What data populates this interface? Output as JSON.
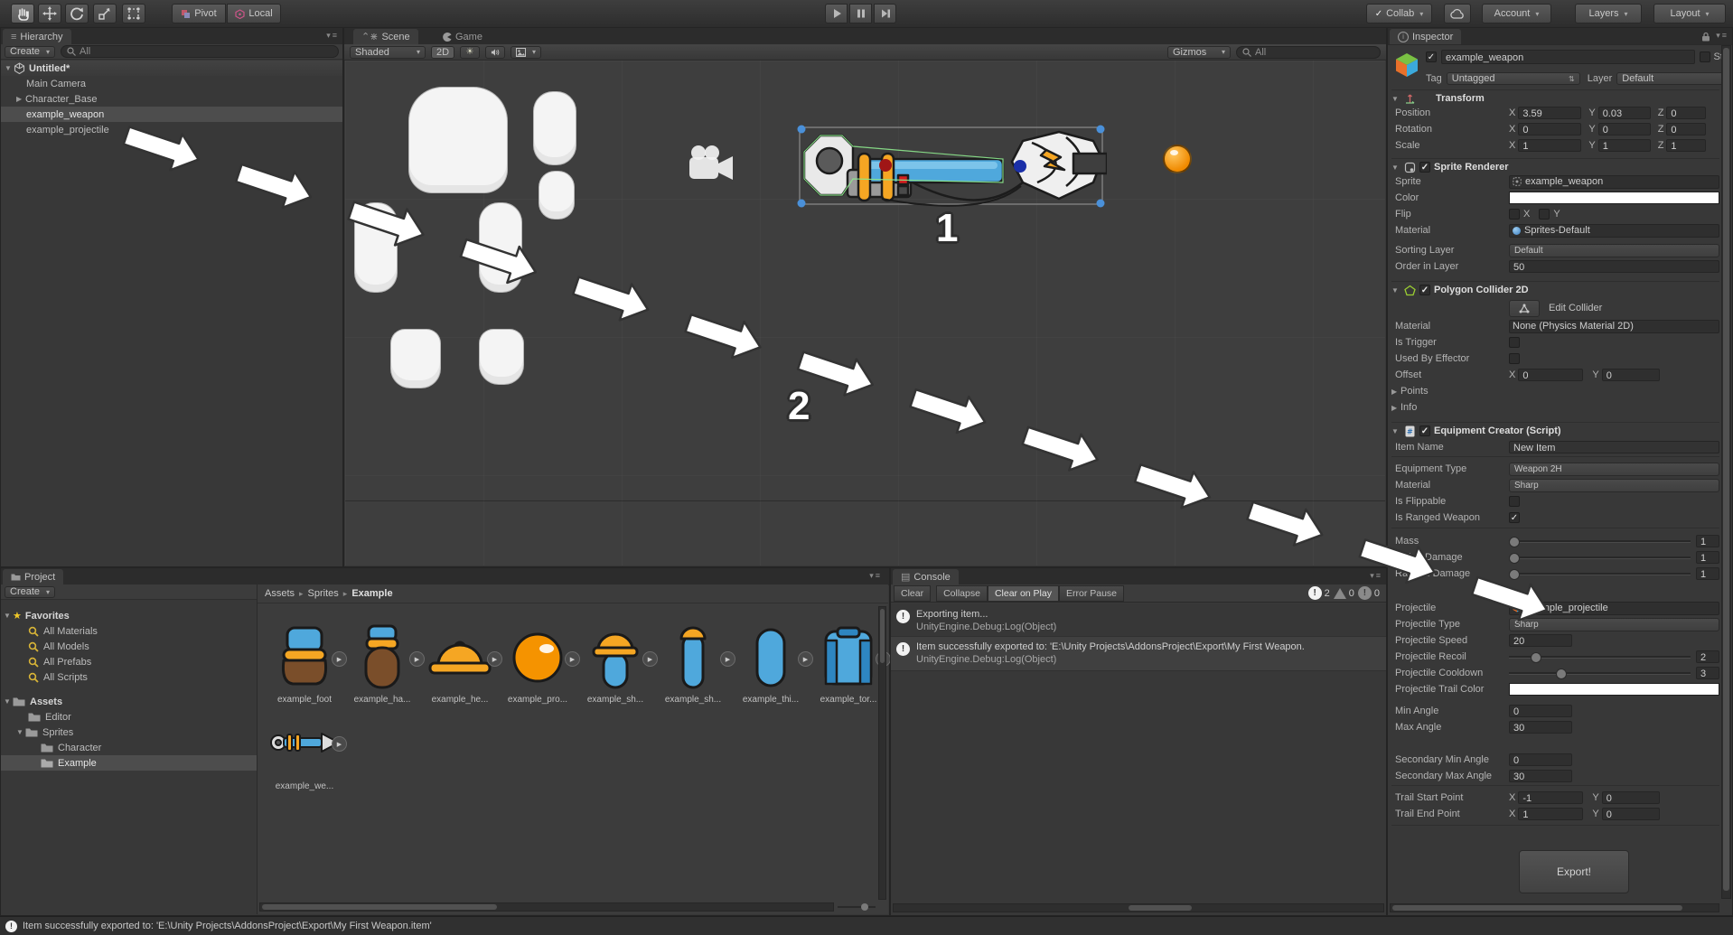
{
  "toolbar": {
    "pivot": "Pivot",
    "local": "Local",
    "collab": "Collab",
    "account": "Account",
    "layers": "Layers",
    "layout": "Layout"
  },
  "hierarchy": {
    "tab": "Hierarchy",
    "create": "Create",
    "search": "All",
    "scene_name": "Untitled*",
    "items": [
      {
        "label": "Main Camera"
      },
      {
        "label": "Character_Base"
      },
      {
        "label": "example_weapon"
      },
      {
        "label": "example_projectile"
      }
    ]
  },
  "scene": {
    "tab_scene": "Scene",
    "tab_game": "Game",
    "shaded": "Shaded",
    "mode_2d": "2D",
    "gizmos": "Gizmos",
    "search": "All",
    "annotation_1": "1",
    "annotation_2": "2"
  },
  "project": {
    "tab": "Project",
    "create": "Create",
    "favorites_label": "Favorites",
    "favorites": [
      {
        "label": "All Materials"
      },
      {
        "label": "All Models"
      },
      {
        "label": "All Prefabs"
      },
      {
        "label": "All Scripts"
      }
    ],
    "assets_label": "Assets",
    "folders": {
      "editor": "Editor",
      "sprites": "Sprites",
      "character": "Character",
      "example": "Example"
    },
    "breadcrumb": {
      "a": "Assets",
      "b": "Sprites",
      "c": "Example"
    },
    "items": [
      {
        "label": "example_foot"
      },
      {
        "label": "example_ha..."
      },
      {
        "label": "example_he..."
      },
      {
        "label": "example_pro..."
      },
      {
        "label": "example_sh..."
      },
      {
        "label": "example_sh..."
      },
      {
        "label": "example_thi..."
      },
      {
        "label": "example_tor..."
      },
      {
        "label": "example_we..."
      }
    ]
  },
  "console": {
    "tab": "Console",
    "clear": "Clear",
    "collapse": "Collapse",
    "clear_on_play": "Clear on Play",
    "error_pause": "Error Pause",
    "log_count": "2",
    "warn_count": "0",
    "error_count": "0",
    "entries": [
      {
        "line1": "Exporting item...",
        "line2": "UnityEngine.Debug:Log(Object)"
      },
      {
        "line1": "Item successfully exported to: 'E:\\Unity Projects\\AddonsProject\\Export\\My First Weapon.",
        "line2": "UnityEngine.Debug:Log(Object)"
      }
    ]
  },
  "inspector": {
    "tab": "Inspector",
    "name": "example_weapon",
    "static_label": "Sta",
    "tag_label": "Tag",
    "tag_value": "Untagged",
    "layer_label": "Layer",
    "layer_value": "Default",
    "axis": {
      "x": "X",
      "y": "Y",
      "z": "Z"
    },
    "transform": {
      "title": "Transform",
      "position": {
        "label": "Position",
        "x": "3.59",
        "y": "0.03",
        "z": "0"
      },
      "rotation": {
        "label": "Rotation",
        "x": "0",
        "y": "0",
        "z": "0"
      },
      "scale": {
        "label": "Scale",
        "x": "1",
        "y": "1",
        "z": "1"
      }
    },
    "sprite_renderer": {
      "title": "Sprite Renderer",
      "sprite_label": "Sprite",
      "sprite_value": "example_weapon",
      "color_label": "Color",
      "flip_label": "Flip",
      "flip_x": "X",
      "flip_y": "Y",
      "material_label": "Material",
      "material_value": "Sprites-Default",
      "sorting_label": "Sorting Layer",
      "sorting_value": "Default",
      "order_label": "Order in Layer",
      "order_value": "50"
    },
    "collider": {
      "title": "Polygon Collider 2D",
      "edit": "Edit Collider",
      "material_label": "Material",
      "material_value": "None (Physics Material 2D)",
      "trigger_label": "Is Trigger",
      "effector_label": "Used By Effector",
      "offset_label": "Offset",
      "x": "0",
      "y": "0",
      "points_label": "Points",
      "info_label": "Info"
    },
    "equipment": {
      "title": "Equipment Creator (Script)",
      "item_name_label": "Item Name",
      "item_name": "New Item",
      "type_label": "Equipment Type",
      "type_value": "Weapon 2H",
      "material_label": "Material",
      "material_value": "Sharp",
      "flippable_label": "Is Flippable",
      "ranged_label": "Is Ranged Weapon",
      "mass_label": "Mass",
      "mass": "1",
      "melee_label": "Melee Damage",
      "melee": "1",
      "ranged_dmg_label": "Ranged Damage",
      "ranged_dmg": "1",
      "projectile_label": "Projectile",
      "projectile_value": "example_projectile",
      "proj_type_label": "Projectile Type",
      "proj_type": "Sharp",
      "speed_label": "Projectile Speed",
      "speed": "20",
      "recoil_label": "Projectile Recoil",
      "recoil": "2",
      "cooldown_label": "Projectile Cooldown",
      "cooldown": "3",
      "trail_color_label": "Projectile Trail Color",
      "min_angle_label": "Min Angle",
      "min_angle": "0",
      "max_angle_label": "Max Angle",
      "max_angle": "30",
      "sec_min_label": "Secondary Min Angle",
      "sec_min": "0",
      "sec_max_label": "Secondary Max Angle",
      "sec_max": "30",
      "trail_start_label": "Trail Start Point",
      "trail_start_x": "-1",
      "trail_start_y": "0",
      "trail_end_label": "Trail End Point",
      "trail_end_x": "1",
      "trail_end_y": "0"
    },
    "export": "Export!"
  },
  "status_bar": {
    "message": "Item successfully exported to: 'E:\\Unity Projects\\AddonsProject\\Export\\My First Weapon.item'"
  }
}
